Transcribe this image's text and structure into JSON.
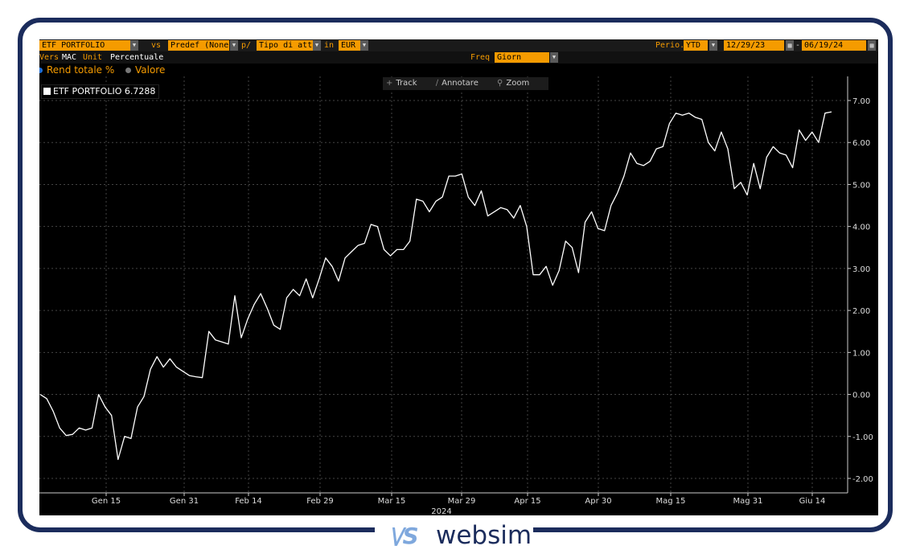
{
  "toolbar": {
    "security": "ETF PORTFOLIO",
    "vs_label": "vs",
    "benchmark": "Predef (None)",
    "per_label": "p/",
    "asset_type": "Tipo di attivo",
    "in_label": "in",
    "currency": "EUR",
    "period_label": "Perio..",
    "period": "YTD",
    "start_date": "12/29/23",
    "end_date": "06/19/24",
    "view_label": "Vers",
    "view_mode": "MAC",
    "unit_label": "Unit",
    "unit": "Percentuale",
    "freq_label": "Freq",
    "freq": "Giorn"
  },
  "options": {
    "total_return": "Rend totale %",
    "value": "Valore"
  },
  "legend": {
    "label": "ETF PORTFOLIO 6.7288"
  },
  "tools": {
    "track": "Track",
    "annotate": "Annotare",
    "zoom": "Zoom"
  },
  "brand": {
    "mark": "\\/S",
    "name": "websim"
  },
  "colors": {
    "accent": "#f59b00",
    "line": "#ffffff",
    "frame": "#1b2c5c"
  },
  "chart_data": {
    "type": "line",
    "series": [
      {
        "name": "ETF PORTFOLIO",
        "values": [
          0.0,
          -0.1,
          -0.4,
          -0.8,
          -0.98,
          -0.95,
          -0.8,
          -0.85,
          -0.8,
          0.0,
          -0.3,
          -0.5,
          -1.55,
          -1.0,
          -1.05,
          -0.3,
          -0.05,
          0.6,
          0.9,
          0.65,
          0.85,
          0.65,
          0.55,
          0.45,
          0.42,
          0.4,
          1.5,
          1.3,
          1.25,
          1.2,
          2.35,
          1.35,
          1.8,
          2.15,
          2.4,
          2.05,
          1.65,
          1.55,
          2.3,
          2.5,
          2.35,
          2.75,
          2.3,
          2.75,
          3.25,
          3.05,
          2.7,
          3.25,
          3.4,
          3.55,
          3.6,
          4.05,
          4.0,
          3.45,
          3.3,
          3.45,
          3.45,
          3.65,
          4.65,
          4.6,
          4.35,
          4.6,
          4.7,
          5.2,
          5.2,
          5.25,
          4.7,
          4.5,
          4.85,
          4.25,
          4.35,
          4.45,
          4.4,
          4.2,
          4.5,
          4.0,
          2.85,
          2.85,
          3.05,
          2.6,
          2.95,
          3.65,
          3.5,
          2.9,
          4.1,
          4.35,
          3.95,
          3.9,
          4.5,
          4.8,
          5.2,
          5.75,
          5.5,
          5.45,
          5.55,
          5.85,
          5.9,
          6.45,
          6.7,
          6.65,
          6.7,
          6.6,
          6.55,
          6.0,
          5.8,
          6.25,
          5.85,
          4.9,
          5.05,
          4.75,
          5.5,
          4.9,
          5.65,
          5.9,
          5.75,
          5.7,
          5.4,
          6.3,
          6.05,
          6.25,
          6.0,
          6.7,
          6.73
        ]
      }
    ],
    "x_ticks": [
      "Gen 15",
      "Gen 31",
      "Feb 14",
      "Feb 29",
      "Mar 15",
      "Mar 29",
      "Apr 15",
      "Apr 30",
      "Mag 15",
      "Mag 31",
      "Giu 14"
    ],
    "x_year": "2024",
    "y_ticks": [
      "7.00",
      "6.00",
      "5.00",
      "4.00",
      "3.00",
      "2.00",
      "1.00",
      "0.00",
      "-1.00",
      "-2.00"
    ],
    "ylim": [
      -2.0,
      7.0
    ],
    "grid": true,
    "legend_placement": "top-left"
  }
}
